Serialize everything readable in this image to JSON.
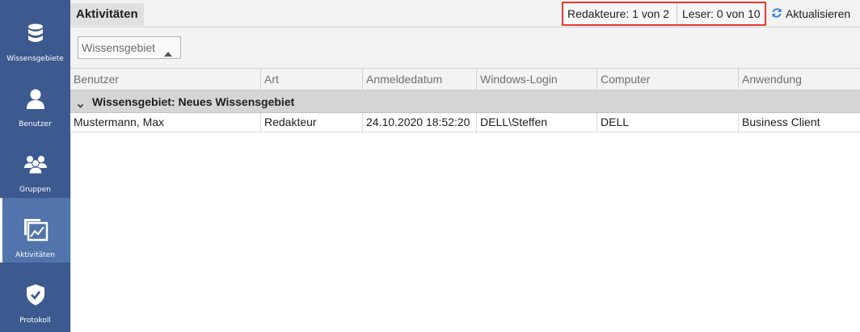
{
  "sidebar": {
    "items": [
      {
        "label": "Wissensgebiete",
        "icon": "database-icon"
      },
      {
        "label": "Benutzer",
        "icon": "user-icon"
      },
      {
        "label": "Gruppen",
        "icon": "group-icon"
      },
      {
        "label": "Aktivitäten",
        "icon": "activity-chart-icon",
        "active": true
      },
      {
        "label": "Protokoll",
        "icon": "shield-check-icon"
      }
    ]
  },
  "header": {
    "title": "Aktivitäten",
    "editors": "Redakteure: 1 von 2",
    "readers": "Leser: 0 von 10",
    "refresh_label": "Aktualisieren"
  },
  "group_panel": {
    "chip_label": "Wissensgebiet"
  },
  "table": {
    "columns": [
      "Benutzer",
      "Art",
      "Anmeldedatum",
      "Windows-Login",
      "Computer",
      "Anwendung"
    ],
    "group_label": "Wissensgebiet: Neues Wissensgebiet",
    "rows": [
      {
        "user": "Mustermann, Max",
        "type": "Redakteur",
        "login_date": "24.10.2020 18:52:20",
        "windows_login": "DELL\\Steffen",
        "computer": "DELL",
        "application": "Business Client"
      }
    ]
  },
  "colors": {
    "sidebar_bg": "#3c5a8f",
    "sidebar_active_bg": "#5274ac",
    "highlight_border": "#e53935",
    "refresh_icon": "#2f7fd8"
  }
}
